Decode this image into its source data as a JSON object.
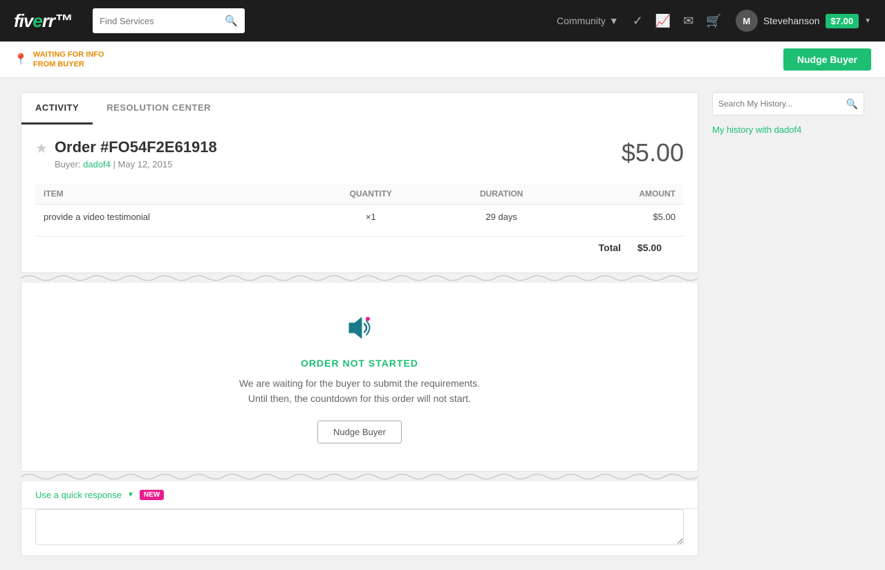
{
  "header": {
    "logo": "fiverr",
    "search_placeholder": "Find Services",
    "community_label": "Community",
    "username": "Stevehanson",
    "balance": "$7.00",
    "avatar_initial": "M"
  },
  "status_bar": {
    "status_line1": "WAITING FOR INFO",
    "status_line2": "FROM BUYER",
    "nudge_button": "Nudge Buyer"
  },
  "tabs": [
    {
      "label": "ACTIVITY",
      "active": true
    },
    {
      "label": "RESOLUTION CENTER",
      "active": false
    }
  ],
  "order": {
    "title": "Order #FO54F2E61918",
    "amount": "$5.00",
    "buyer_label": "Buyer:",
    "buyer_name": "dadof4",
    "date_separator": "|",
    "date": "May 12, 2015",
    "table": {
      "columns": [
        "ITEM",
        "QUANTITY",
        "DURATION",
        "AMOUNT"
      ],
      "rows": [
        {
          "item": "provide a video testimonial",
          "quantity": "×1",
          "duration": "29 days",
          "amount": "$5.00"
        }
      ],
      "total_label": "Total",
      "total_amount": "$5.00"
    }
  },
  "not_started": {
    "label": "ORDER NOT STARTED",
    "description_line1": "We are waiting for the buyer to submit the requirements.",
    "description_line2": "Until then, the countdown for this order will not start.",
    "nudge_button": "Nudge Buyer"
  },
  "quick_response": {
    "link_label": "Use a quick response",
    "new_badge": "NEW"
  },
  "sidebar": {
    "search_placeholder": "Search My History...",
    "history_link": "My history with dadof4"
  }
}
